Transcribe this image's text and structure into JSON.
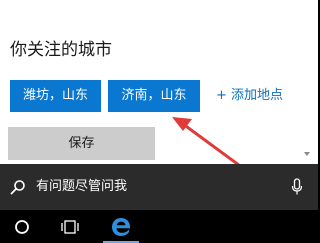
{
  "weather_settings": {
    "section_title": "你关注的城市",
    "cities": [
      {
        "label": "潍坊，山东"
      },
      {
        "label": "济南，山东"
      }
    ],
    "add_location_label": "+ 添加地点",
    "save_label": "保存"
  },
  "search": {
    "placeholder": "有问题尽管问我"
  },
  "taskbar": {
    "icons": [
      "cortana-icon",
      "task-view-icon",
      "edge-icon"
    ]
  },
  "colors": {
    "accent": "#0a78d0",
    "annotation_arrow": "#e03a3a",
    "search_bar": "#2b2b2b",
    "taskbar": "#000000"
  }
}
